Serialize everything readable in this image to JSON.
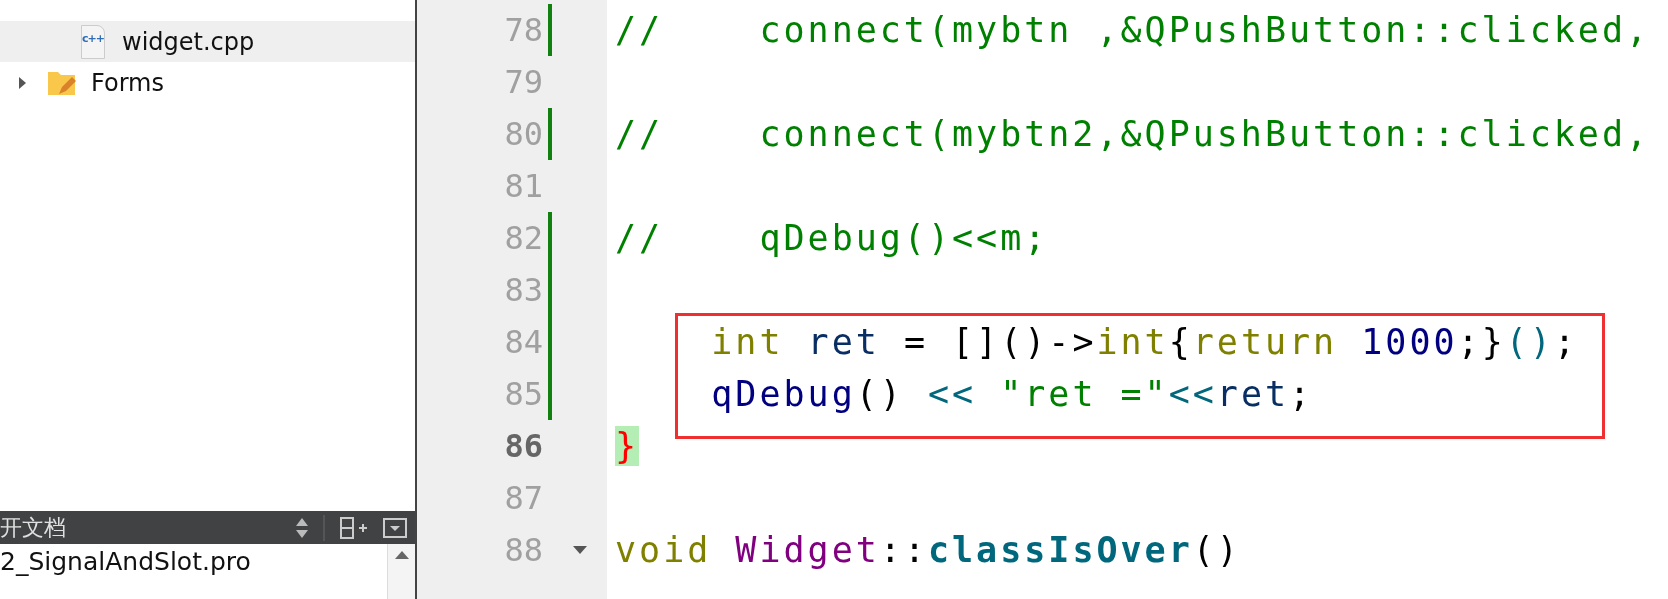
{
  "project_tree": {
    "items": [
      {
        "children": [
          {
            "label": "widget.cpp",
            "kind": "file",
            "badge": "c++",
            "selected": true
          }
        ]
      },
      {
        "label": "Forms",
        "kind": "folder",
        "selected": false,
        "expanded": false
      }
    ]
  },
  "open_documents": {
    "title": "开文档",
    "items": [
      {
        "label": "2_SignalAndSlot.pro",
        "selected": false
      }
    ]
  },
  "editor": {
    "lines": [
      {
        "number": "78",
        "modified": true,
        "current": false,
        "foldable": false,
        "boxed": false,
        "tokens": [
          {
            "t": "//    connect(mybtn ,&QPushButton::clicked,",
            "kind": "comment"
          }
        ]
      },
      {
        "number": "79",
        "modified": false,
        "current": false,
        "foldable": false,
        "boxed": false
      },
      {
        "number": "80",
        "modified": true,
        "current": false,
        "foldable": false,
        "boxed": false,
        "tokens": [
          {
            "t": "//    connect(mybtn2,&QPushButton::clicked,",
            "kind": "comment"
          }
        ]
      },
      {
        "number": "81",
        "modified": false,
        "current": false,
        "foldable": false,
        "boxed": false
      },
      {
        "number": "82",
        "modified": true,
        "current": false,
        "foldable": false,
        "boxed": false,
        "tokens": [
          {
            "t": "//    qDebug()<<m;",
            "kind": "comment"
          }
        ]
      },
      {
        "number": "83",
        "modified": true,
        "current": false,
        "foldable": false,
        "boxed": false
      },
      {
        "number": "84",
        "modified": true,
        "current": false,
        "foldable": false,
        "boxed": true,
        "tokens": [
          {
            "t": "    int",
            "kind": "keyword"
          },
          {
            "t": " ret",
            "kind": "variable"
          },
          {
            "t": " = []()->",
            "kind": "punct"
          },
          {
            "t": "int",
            "kind": "keyword"
          },
          {
            "t": "{",
            "kind": "punct"
          },
          {
            "t": "return",
            "kind": "keyword"
          },
          {
            "t": " 1000",
            "kind": "number"
          },
          {
            "t": ";}",
            "kind": "punct"
          },
          {
            "t": "()",
            "kind": "call_parens"
          },
          {
            "t": ";",
            "kind": "punct"
          }
        ]
      },
      {
        "number": "85",
        "modified": true,
        "current": false,
        "foldable": false,
        "boxed": true,
        "tokens": [
          {
            "t": "    qDebug",
            "kind": "call"
          },
          {
            "t": "() ",
            "kind": "punct"
          },
          {
            "t": "<<",
            "kind": "operator"
          },
          {
            "t": " \"ret =\"",
            "kind": "string"
          },
          {
            "t": "<<",
            "kind": "operator"
          },
          {
            "t": "ret",
            "kind": "variable"
          },
          {
            "t": ";",
            "kind": "punct"
          }
        ]
      },
      {
        "number": "86",
        "modified": false,
        "current": true,
        "foldable": false,
        "boxed": false,
        "tokens": [
          {
            "t": "}",
            "kind": "brace_match"
          }
        ]
      },
      {
        "number": "87",
        "modified": false,
        "current": false,
        "foldable": false,
        "boxed": false
      },
      {
        "number": "88",
        "modified": false,
        "current": false,
        "foldable": true,
        "boxed": false,
        "tokens": [
          {
            "t": "void",
            "kind": "keyword"
          },
          {
            "t": " Widget",
            "kind": "class"
          },
          {
            "t": "::",
            "kind": "punct"
          },
          {
            "t": "classIsOver",
            "kind": "method"
          },
          {
            "t": "()",
            "kind": "punct"
          }
        ]
      }
    ]
  }
}
